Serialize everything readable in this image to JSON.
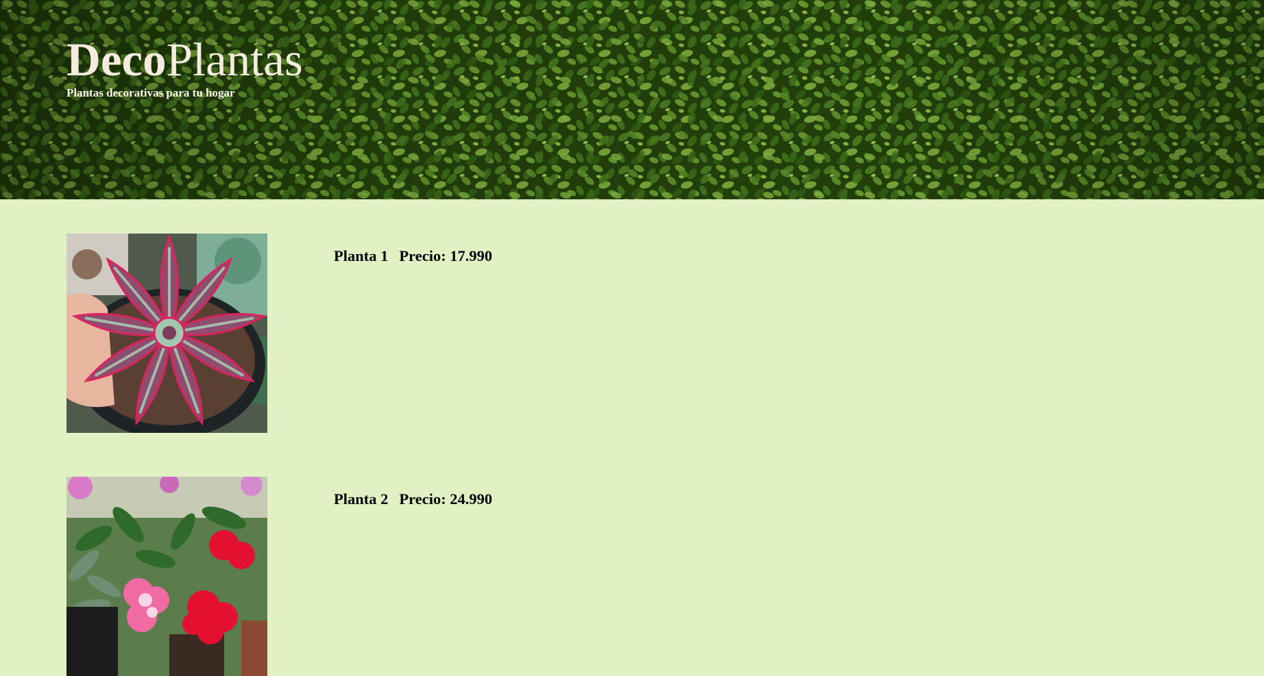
{
  "header": {
    "title_bold": "Deco",
    "title_regular": "Plantas",
    "subtitle": "Plantas decorativas para tu hogar",
    "background_image": "hedge-leaves"
  },
  "colors": {
    "page_background": "#e2f1c3",
    "header_text": "#f4ecdc",
    "hedge_green": "#3d6a1c"
  },
  "products": [
    {
      "name": "Planta 1",
      "price_label": "Precio: 17.990",
      "image": "pink-striped-succulent"
    },
    {
      "name": "Planta 2",
      "price_label": "Precio: 24.990",
      "image": "red-pink-flowering-plants"
    }
  ]
}
